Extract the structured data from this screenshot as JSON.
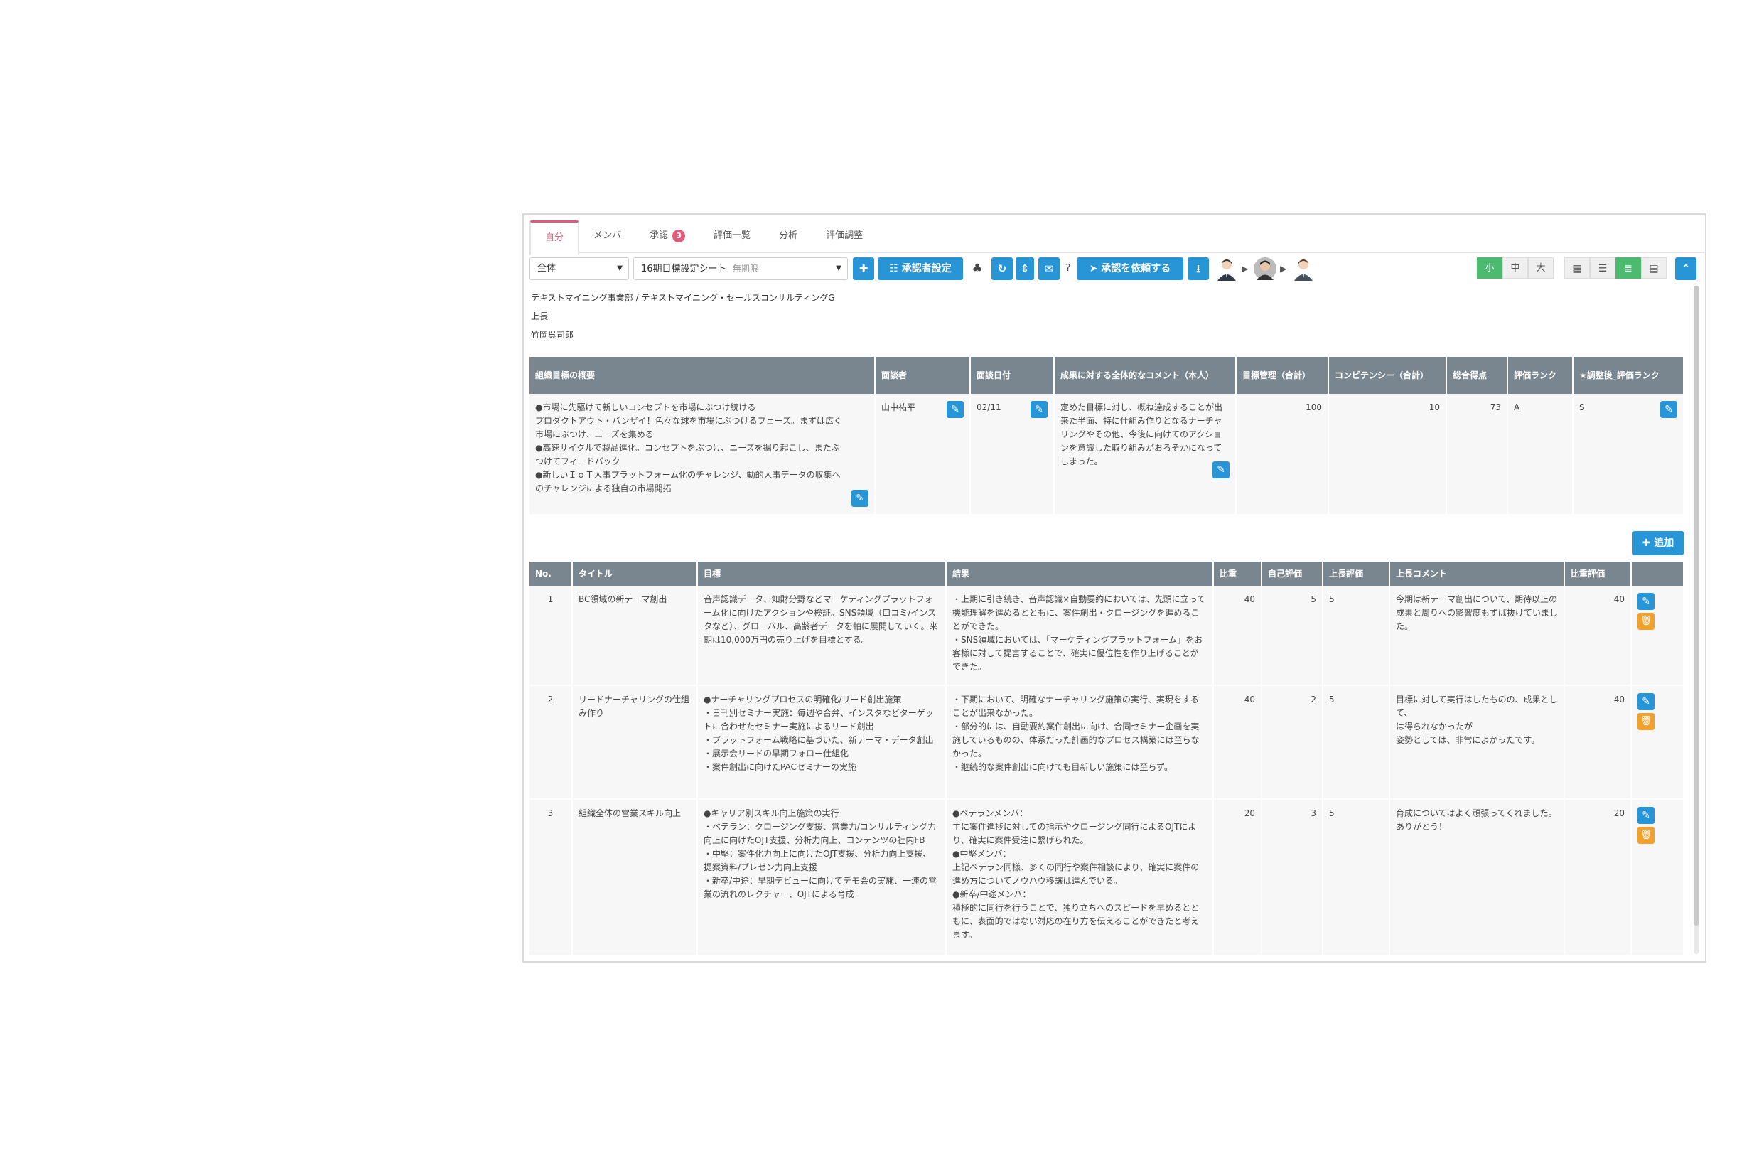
{
  "tabs": [
    {
      "label": "自分",
      "active": true
    },
    {
      "label": "メンバ"
    },
    {
      "label": "承認",
      "badge": "3"
    },
    {
      "label": "評価一覧"
    },
    {
      "label": "分析"
    },
    {
      "label": "評価調整"
    }
  ],
  "toolbar": {
    "scope_select": "全体",
    "sheet_select": "16期目標設定シート",
    "sheet_status": "無期限",
    "approver_setting_label": "承認者設定",
    "request_approval_label": "承認を依頼する",
    "size_options": [
      "小",
      "中",
      "大"
    ],
    "selected_size": "小"
  },
  "org": {
    "department": "テキストマイニング事業部 / テキストマイニング・セールスコンサルティングG",
    "role": "上長",
    "name": "竹岡呉司郎"
  },
  "summary": {
    "headers": [
      "組織目標の概要",
      "面談者",
      "面談日付",
      "成果に対する全体的なコメント（本人）",
      "目標管理（合計）",
      "コンピテンシー（合計）",
      "総合得点",
      "評価ランク",
      "★調整後_評価ランク"
    ],
    "row": {
      "overview": "●市場に先駆けて新しいコンセプトを市場にぶつけ続ける\nプロダクトアウト・バンザイ！色々な球を市場にぶつけるフェーズ。まずは広く市場にぶつけ、ニーズを集める\n●高速サイクルで製品進化。コンセプトをぶつけ、ニーズを掘り起こし、またぶつけてフィードバック\n●新しいＩｏＴ人事プラットフォーム化のチャレンジ、動的人事データの収集へのチャレンジによる独自の市場開拓",
      "interviewer": "山中祐平",
      "date": "02/11",
      "comment": "定めた目標に対し、概ね達成することが出来た半面、特に仕組み作りとなるナーチャリングやその他、今後に向けてのアクションを意識した取り組みがおろそかになってしまった。",
      "goal_total": "100",
      "competency_total": "10",
      "total_score": "73",
      "rank": "A",
      "adjusted_rank": "S"
    }
  },
  "add_label": "追加",
  "goals": {
    "headers": [
      "No.",
      "タイトル",
      "目標",
      "結果",
      "比重",
      "自己評価",
      "上長評価",
      "上長コメント",
      "比重評価"
    ],
    "rows": [
      {
        "no": "1",
        "title": "BC領域の新テーマ創出",
        "goal": "音声認識データ、知財分野などマーケティングプラットフォーム化に向けたアクションや検証。SNS領域（口コミ/インスタなど）、グローバル、高齢者データを軸に展開していく。来期は10,000万円の売り上げを目標とする。",
        "result": "・上期に引き続き、音声認識×自動要約においては、先頭に立って機能理解を進めるとともに、案件創出・クロージングを進めることができた。\n・SNS領域においては、「マーケティングプラットフォーム」をお客様に対して提言することで、確実に優位性を作り上げることができた。",
        "weight": "40",
        "self": "5",
        "boss": "5",
        "boss_comment": "今期は新テーマ創出について、期待以上の成果と周りへの影響度もずば抜けていました。",
        "weighted": "40"
      },
      {
        "no": "2",
        "title": "リードナーチャリングの仕組み作り",
        "goal": "●ナーチャリングプロセスの明確化/リード創出施策\n・日刊別セミナー実施：毎週や合弁、インスタなどターゲットに合わせたセミナー実施によるリード創出\n・プラットフォーム戦略に基づいた、新テーマ・データ創出\n・展示会リードの早期フォロー仕組化\n・案件創出に向けたPACセミナーの実施",
        "result": "・下期において、明確なナーチャリング施策の実行、実現をすることが出来なかった。\n・部分的には、自動要約案件創出に向け、合同セミナー企画を実施しているものの、体系だった計画的なプロセス構築には至らなかった。\n・継続的な案件創出に向けても目新しい施策には至らず。",
        "weight": "40",
        "self": "2",
        "boss": "5",
        "boss_comment": "目標に対して実行はしたものの、成果として、\nは得られなかったが\n姿勢としては、非常によかったです。",
        "weighted": "40"
      },
      {
        "no": "3",
        "title": "組織全体の営業スキル向上",
        "goal": "●キャリア別スキル向上施策の実行\n・ベテラン：クロージング支援、営業力/コンサルティング力向上に向けたOJT支援、分析力向上、コンテンツの社内FB\n・中堅：案件化力向上に向けたOJT支援、分析力向上支援、提案資料/プレゼン力向上支援\n・新卒/中途：早期デビューに向けてデモ会の実施、一連の営業の流れのレクチャー、OJTによる育成",
        "result": "●ベテランメンバ：\n主に案件進捗に対しての指示やクロージング同行によるOJTにより、確実に案件受注に繋げられた。\n●中堅メンバ：\n上記ベテラン同様、多くの同行や案件相談により、確実に案件の進め方についてノウハウ移譲は進んでいる。\n●新卒/中途メンバ：\n積極的に同行を行うことで、独り立ちへのスピードを早めるとともに、表面的ではない対応の在り方を伝えることができたと考えます。",
        "weight": "20",
        "self": "3",
        "boss": "5",
        "boss_comment": "育成についてはよく頑張ってくれました。\nありがとう！",
        "weighted": "20"
      }
    ]
  },
  "colors": {
    "accent": "#2795d6",
    "header": "#7a868f",
    "tab_active": "#e05a7a",
    "size_on": "#4cbb6f",
    "delete": "#f0a02b"
  }
}
